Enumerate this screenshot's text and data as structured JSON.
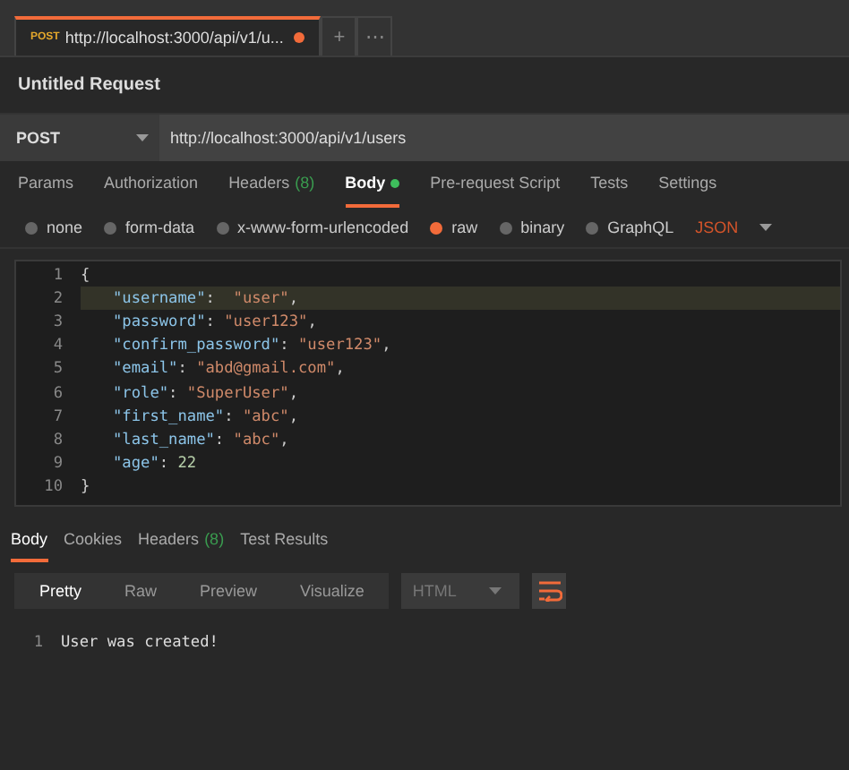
{
  "request_tabs": [
    {
      "method": "POST",
      "label": "http://localhost:3000/api/v1/u...",
      "unsaved": true,
      "selected": true
    }
  ],
  "tab_actions": [
    "+",
    "⋯"
  ],
  "title": "Untitled Request",
  "request": {
    "method": "POST",
    "url": "http://localhost:3000/api/v1/users"
  },
  "request_tabs_bar": [
    {
      "label": "Params",
      "selected": false,
      "dot": false
    },
    {
      "label": "Authorization",
      "selected": false,
      "dot": false
    },
    {
      "label": "Headers",
      "count": "(8)",
      "selected": false,
      "dot": false
    },
    {
      "label": "Body",
      "selected": true,
      "dot": true
    },
    {
      "label": "Pre-request Script",
      "selected": false,
      "dot": false
    },
    {
      "label": "Tests",
      "selected": false,
      "dot": false
    },
    {
      "label": "Settings",
      "selected": false,
      "dot": false
    }
  ],
  "body_types": [
    {
      "label": "none",
      "selected": false
    },
    {
      "label": "form-data",
      "selected": false
    },
    {
      "label": "x-www-form-urlencoded",
      "selected": false
    },
    {
      "label": "raw",
      "selected": true
    },
    {
      "label": "binary",
      "selected": false
    },
    {
      "label": "GraphQL",
      "selected": false
    }
  ],
  "body_format": "JSON",
  "editor_lines": [
    {
      "number": "1",
      "highlighted": false,
      "tokens": [
        {
          "kind": "punct",
          "text": "{"
        }
      ]
    },
    {
      "number": "2",
      "highlighted": true,
      "tokens": [
        {
          "kind": "key",
          "text": "\"username\""
        },
        {
          "kind": "punct",
          "text": ":  "
        },
        {
          "kind": "str",
          "text": "\"user\""
        },
        {
          "kind": "punct",
          "text": ","
        }
      ]
    },
    {
      "number": "3",
      "highlighted": false,
      "tokens": [
        {
          "kind": "key",
          "text": "\"password\""
        },
        {
          "kind": "punct",
          "text": ": "
        },
        {
          "kind": "str",
          "text": "\"user123\""
        },
        {
          "kind": "punct",
          "text": ","
        }
      ]
    },
    {
      "number": "4",
      "highlighted": false,
      "tokens": [
        {
          "kind": "key",
          "text": "\"confirm_password\""
        },
        {
          "kind": "punct",
          "text": ": "
        },
        {
          "kind": "str",
          "text": "\"user123\""
        },
        {
          "kind": "punct",
          "text": ","
        }
      ]
    },
    {
      "number": "5",
      "highlighted": false,
      "tokens": [
        {
          "kind": "key",
          "text": "\"email\""
        },
        {
          "kind": "punct",
          "text": ": "
        },
        {
          "kind": "str",
          "text": "\"abd@gmail.com\""
        },
        {
          "kind": "punct",
          "text": ","
        }
      ]
    },
    {
      "number": "6",
      "highlighted": false,
      "tokens": [
        {
          "kind": "key",
          "text": "\"role\""
        },
        {
          "kind": "punct",
          "text": ": "
        },
        {
          "kind": "str",
          "text": "\"SuperUser\""
        },
        {
          "kind": "punct",
          "text": ","
        }
      ]
    },
    {
      "number": "7",
      "highlighted": false,
      "tokens": [
        {
          "kind": "key",
          "text": "\"first_name\""
        },
        {
          "kind": "punct",
          "text": ": "
        },
        {
          "kind": "str",
          "text": "\"abc\""
        },
        {
          "kind": "punct",
          "text": ","
        }
      ]
    },
    {
      "number": "8",
      "highlighted": false,
      "tokens": [
        {
          "kind": "key",
          "text": "\"last_name\""
        },
        {
          "kind": "punct",
          "text": ": "
        },
        {
          "kind": "str",
          "text": "\"abc\""
        },
        {
          "kind": "punct",
          "text": ","
        }
      ]
    },
    {
      "number": "9",
      "highlighted": false,
      "tokens": [
        {
          "kind": "key",
          "text": "\"age\""
        },
        {
          "kind": "punct",
          "text": ": "
        },
        {
          "kind": "num",
          "text": "22"
        }
      ]
    },
    {
      "number": "10",
      "highlighted": false,
      "tokens": [
        {
          "kind": "punct",
          "text": "}"
        }
      ]
    }
  ],
  "response_tabs": [
    {
      "label": "Body",
      "selected": true
    },
    {
      "label": "Cookies",
      "selected": false
    },
    {
      "label": "Headers",
      "count": "(8)",
      "selected": false
    },
    {
      "label": "Test Results",
      "selected": false
    }
  ],
  "view_modes": [
    {
      "label": "Pretty",
      "selected": true
    },
    {
      "label": "Raw",
      "selected": false
    },
    {
      "label": "Preview",
      "selected": false
    },
    {
      "label": "Visualize",
      "selected": false
    }
  ],
  "response_format": "HTML",
  "response_lines": [
    {
      "number": "1",
      "text": "User was created!"
    }
  ]
}
